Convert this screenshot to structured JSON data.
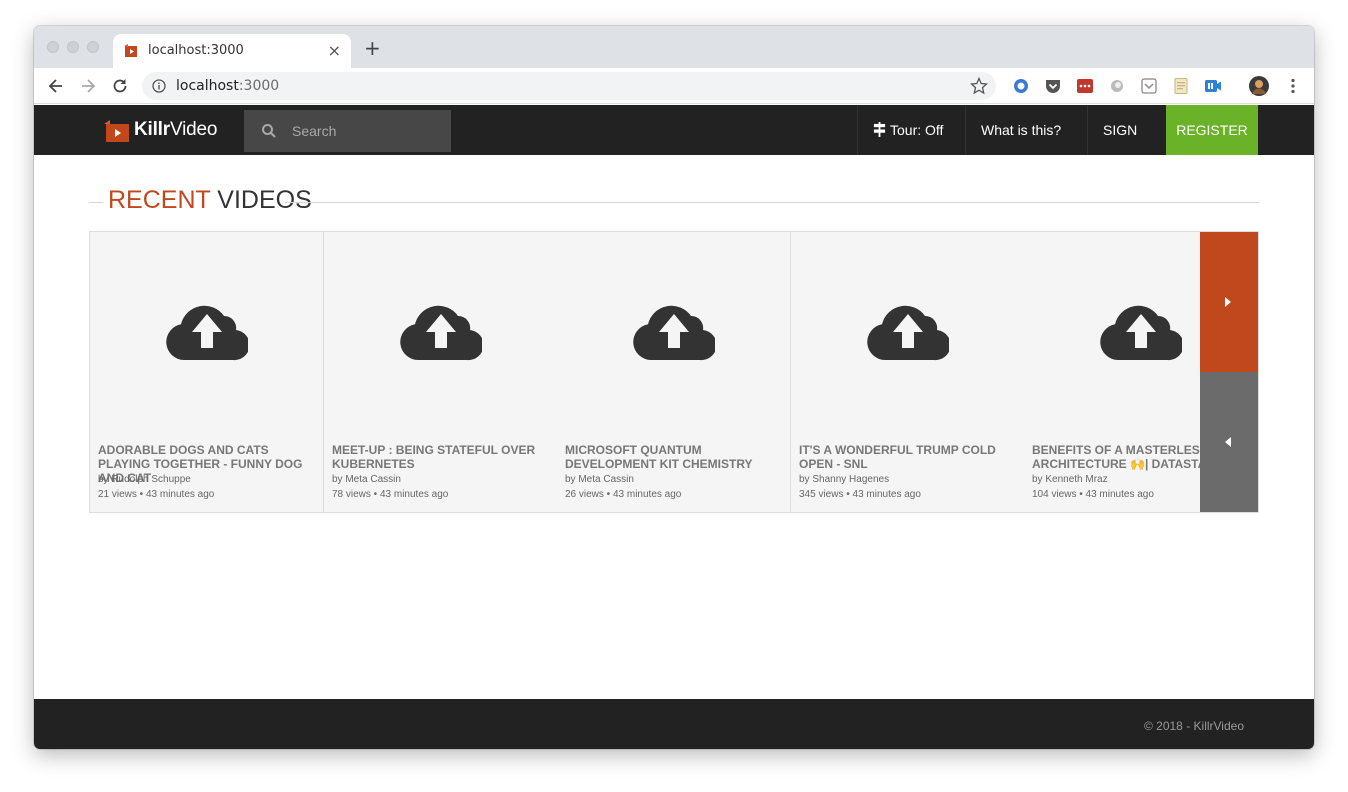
{
  "browser": {
    "tab_title": "localhost:3000",
    "tab_close": "×",
    "new_tab": "+",
    "url_host": "localhost",
    "url_port": ":3000"
  },
  "nav": {
    "brand_bold": "Killr",
    "brand_thin": "Video",
    "search_placeholder": "Search",
    "tour_label": "Tour: Off",
    "what_label": "What is this?",
    "signin_label": "SIGN IN",
    "register_label": "REGISTER"
  },
  "section": {
    "title_highlight": "RECENT",
    "title_rest": " VIDEOS"
  },
  "videos": [
    {
      "title": "ADORABLE DOGS AND CATS PLAYING TOGETHER - FUNNY DOG AND CAT",
      "author": "by Rudolph Schuppe",
      "meta": "21 views • 43 minutes ago"
    },
    {
      "title": "MEET-UP : BEING STATEFUL OVER KUBERNETES",
      "author": "by Meta Cassin",
      "meta": "78 views • 43 minutes ago"
    },
    {
      "title": "MICROSOFT QUANTUM DEVELOPMENT KIT CHEMISTRY",
      "author": "by Meta Cassin",
      "meta": "26 views • 43 minutes ago"
    },
    {
      "title": "IT'S A WONDERFUL TRUMP COLD OPEN - SNL",
      "author": "by Shanny Hagenes",
      "meta": "345 views • 43 minutes ago"
    },
    {
      "title": "BENEFITS OF A MASTERLESS ARCHITECTURE 🙌| DATASTAX",
      "author": "by Kenneth Mraz",
      "meta": "104 views • 43 minutes ago"
    }
  ],
  "footer": {
    "copyright": "© 2018 - KillrVideo"
  },
  "colors": {
    "accent": "#c1481d",
    "register": "#6ab329",
    "navbar": "#222222"
  }
}
